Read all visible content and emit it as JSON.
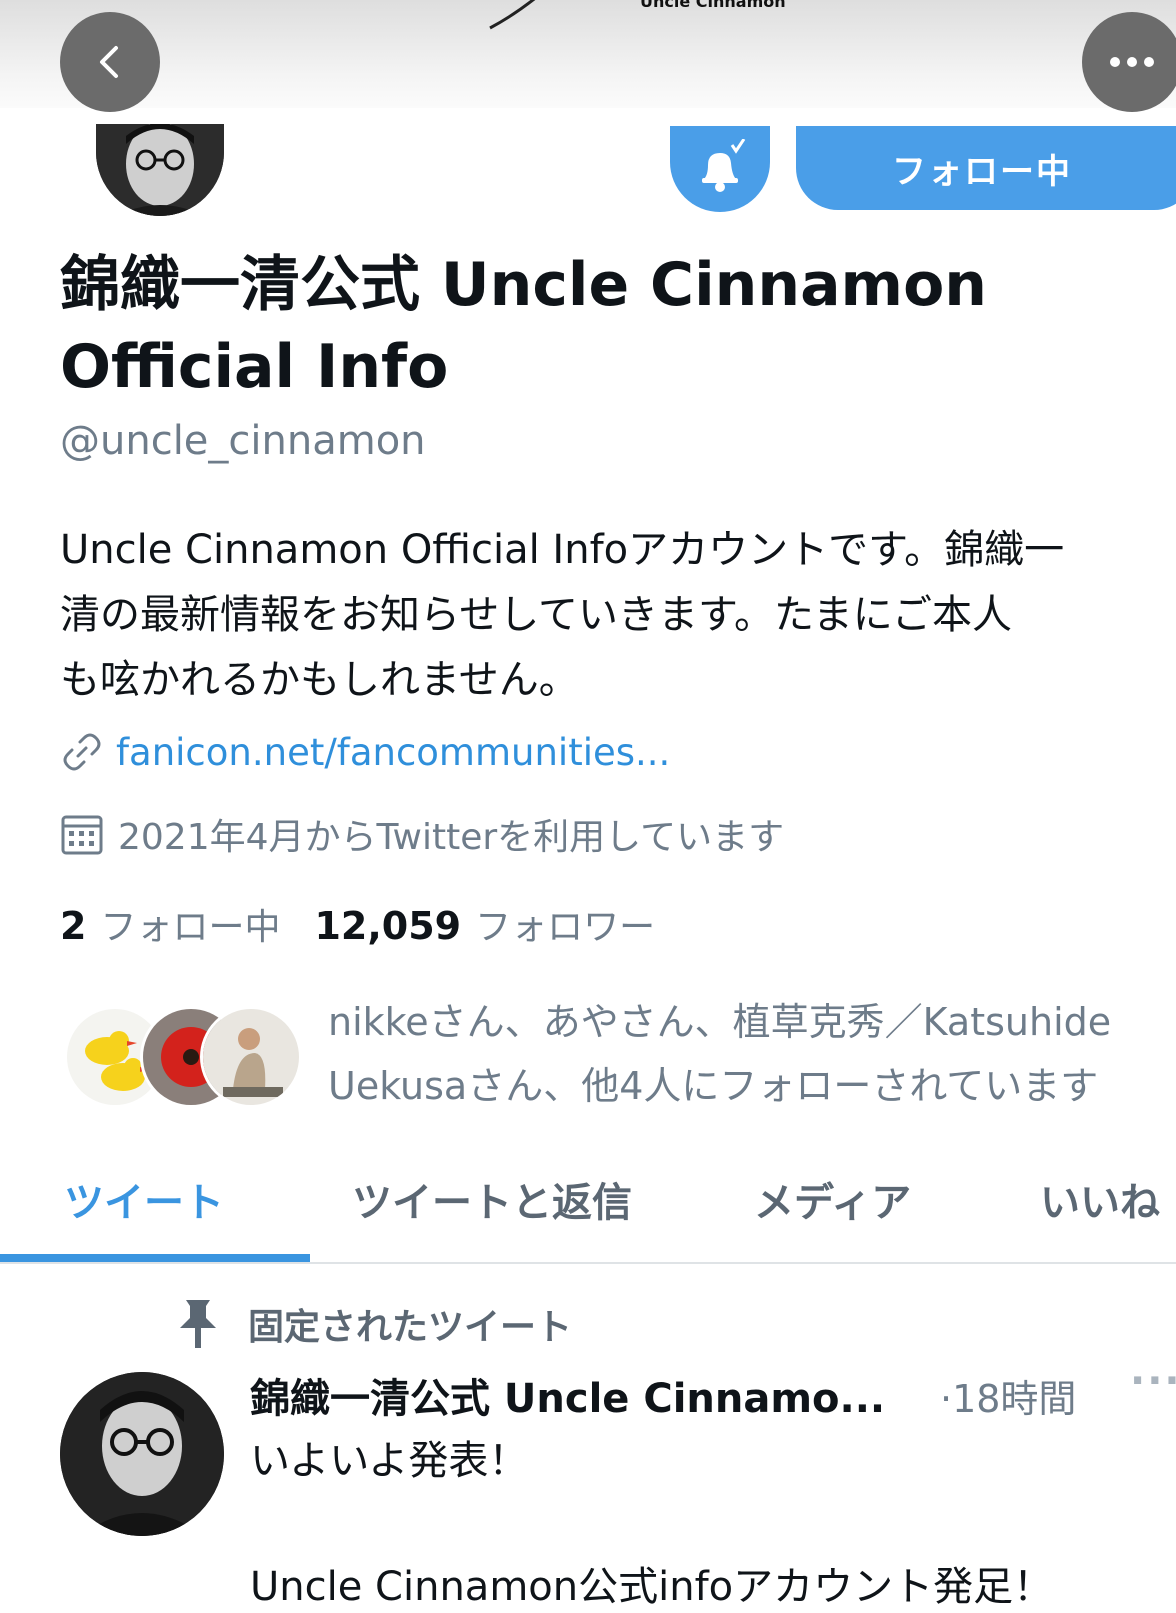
{
  "banner": {
    "logo_text": "Uncle Cinnamon"
  },
  "profile": {
    "display_name": "錦織一清公式 Uncle Cinnamon Official Info",
    "handle": "@uncle_cinnamon",
    "bio": "Uncle Cinnamon Official Infoアカウントです。錦織一\n清の最新情報をお知らせしていきます。たまにご本人\nも呟かれるかもしれません。",
    "link": "fanicon.net/fancommunities...",
    "joined": "2021年4月からTwitterを利用しています",
    "following_count": "2",
    "following_label": "フォロー中",
    "followers_count": "12,059",
    "followers_label": "フォロワー",
    "mutuals_text": "nikkeさん、あやさん、植草克秀／Katsuhide Uekusaさん、他4人にフォローされています"
  },
  "header_actions": {
    "follow_label": "フォロー中"
  },
  "tabs": [
    {
      "label": "ツイート"
    },
    {
      "label": "ツイートと返信"
    },
    {
      "label": "メディア"
    },
    {
      "label": "いいね"
    }
  ],
  "pinned": {
    "label": "固定されたツイート",
    "author": "錦織一清公式 Uncle Cinnamo...",
    "time": "·18時間",
    "more": "···",
    "line1": "いよいよ発表！",
    "line2": "Uncle Cinnamon公式infoアカウント発足！"
  },
  "colors": {
    "accent": "#3a95e0",
    "button": "#4a9ee8",
    "muted": "#6e7c8a"
  },
  "icons": [
    "back-arrow-icon",
    "more-dots-icon",
    "bell-check-icon",
    "link-icon",
    "calendar-icon",
    "pin-icon"
  ]
}
